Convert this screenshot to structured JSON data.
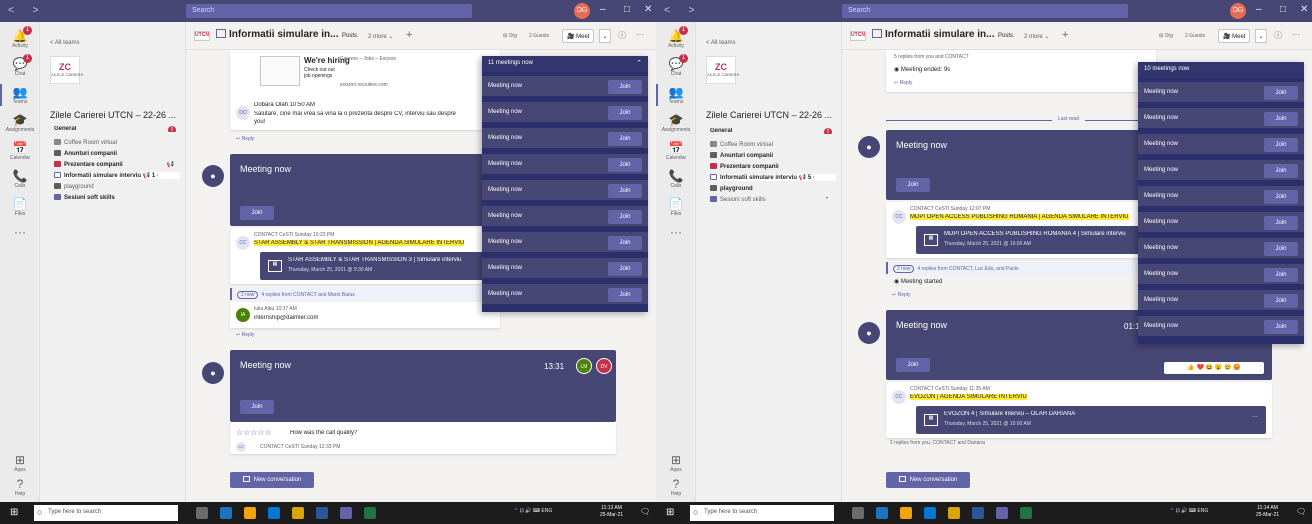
{
  "colors": {
    "brand": "#6264a7",
    "titlebar": "#464775",
    "meeting_card": "#464775",
    "overlay": "#2b2f6b",
    "alert": "#c4314b",
    "highlight": "#ffeb3b"
  },
  "titlebar": {
    "nav": "< >",
    "search_placeholder": "Search",
    "avatar_initials": "DG",
    "minimize": "–",
    "maximize": "□",
    "close": "✕"
  },
  "rail": [
    {
      "name": "activity",
      "label": "Activity",
      "icon": "bell-icon",
      "glyph": "🔔",
      "badge": "1"
    },
    {
      "name": "chat",
      "label": "Chat",
      "icon": "chat-icon",
      "glyph": "💬",
      "badge": "1"
    },
    {
      "name": "teams",
      "label": "Teams",
      "icon": "teams-icon",
      "glyph": "👥"
    },
    {
      "name": "assignments",
      "label": "Assignments",
      "icon": "assignments-icon",
      "glyph": "🎓"
    },
    {
      "name": "calendar",
      "label": "Calendar",
      "icon": "calendar-icon",
      "glyph": "📅"
    },
    {
      "name": "calls",
      "label": "Calls",
      "icon": "phone-icon",
      "glyph": "📞"
    },
    {
      "name": "files",
      "label": "Files",
      "icon": "files-icon",
      "glyph": "📄"
    },
    {
      "name": "more",
      "label": "",
      "icon": "more-icon",
      "glyph": "···"
    }
  ],
  "rail_bottom": [
    {
      "name": "apps",
      "label": "Apps",
      "icon": "apps-icon",
      "glyph": "⊞"
    },
    {
      "name": "help",
      "label": "Help",
      "icon": "help-icon",
      "glyph": "?"
    }
  ],
  "teampanel": {
    "all_teams": "< All teams",
    "logo_mark": "ZC",
    "logo_text": "ZILELE CARIERII",
    "team_name": "Zilele Carierei UTCN – 22-26 ...",
    "team_name_right": "Zilele Carierei UTCN – 22-26 ...",
    "channels_left": [
      {
        "label": "General",
        "style": "bold",
        "icon": "",
        "alert": "!"
      },
      {
        "label": "Coffee Room virtual",
        "style": "dim",
        "icon": "coffee-icon"
      },
      {
        "label": "Anunturi companii",
        "style": "bold",
        "icon": "megaphone-icon"
      },
      {
        "label": "Prezentare companii",
        "style": "bold",
        "icon": "building-icon",
        "extra": "📢"
      },
      {
        "label": "Informatii simulare interviu",
        "style": "bold sel",
        "icon": "window-icon",
        "extra": "📢 1 ·"
      },
      {
        "label": "playground",
        "style": "dim",
        "icon": "play-icon"
      },
      {
        "label": "Sesiuni soft skills",
        "style": "bold",
        "icon": "window-icon"
      }
    ],
    "channels_right": [
      {
        "label": "General",
        "style": "bold",
        "icon": "",
        "alert": "!"
      },
      {
        "label": "Coffee Room virtual",
        "style": "dim",
        "icon": "coffee-icon"
      },
      {
        "label": "Anunturi companii",
        "style": "bold",
        "icon": "megaphone-icon"
      },
      {
        "label": "Prezentare companii",
        "style": "bold",
        "icon": "building-icon"
      },
      {
        "label": "Informatii simulare interviu",
        "style": "bold sel",
        "icon": "window-icon",
        "extra": "📢 5 ·"
      },
      {
        "label": "playground",
        "style": "bold",
        "icon": "play-icon"
      },
      {
        "label": "Sesiuni soft skills",
        "style": "dim",
        "icon": "window-icon",
        "extra": "•"
      }
    ]
  },
  "channel_header": {
    "logo": "UTCN",
    "title": "Informatii simulare in...",
    "posts_tab": "Posts",
    "more_tab": "2 more ⌄",
    "add_tab": "+",
    "org": "⊞ Org",
    "guests": "2 Guests",
    "meet": "🎥 Meet",
    "caret": "⌄",
    "info": "ⓘ",
    "more": "···"
  },
  "left": {
    "hiring_card": {
      "title": "We're hiring",
      "sub1": "Check out our",
      "sub2": "job openings",
      "tags": "Careers – Jobs – Evozon",
      "link": "evozon.recruitee.com"
    },
    "message1": {
      "avatar": "DO",
      "author": "Dobara Olah",
      "time": "10:50 AM",
      "body": "Salutare, cine mai vrea sa vina la o prezenta despre CV, interviu sau despre",
      "body2": "you!",
      "reply": "↩ Reply"
    },
    "meeting1": {
      "title": "Meeting now",
      "join": "Join",
      "icon": "camera-icon"
    },
    "message2": {
      "avatar": "CC",
      "author": "CONTACT CeSTI",
      "time": "Sunday 10:23 PM",
      "headline": "STAR ASSEMBLY & STAR TRANSMISSION | AGENDA SIMULARE INTERVIU",
      "sub_title": "STAR ASSEMBLY & STAR TRANSMISSION 3 | Simulare interviu",
      "sub_when": "Thursday, March 25, 2021 @ 9:30 AM",
      "new_pill": "2 new",
      "replies": "4 replies from CONTACT and Mario Barus"
    },
    "message3": {
      "avatar": "IA",
      "author": "Iulia Albu",
      "time": "10:37 AM",
      "body": "internship@daimler.com",
      "reply": "↩ Reply"
    },
    "meeting2": {
      "title": "Meeting now",
      "time": "13:31",
      "join": "Join",
      "p1": "LM",
      "p2": "DV"
    },
    "rating": {
      "stars": "☆☆☆☆☆",
      "question": "How was the call quality?"
    },
    "message4": {
      "avatar": "CC",
      "author": "CONTACT CeSTI",
      "time": "Sunday 12:33 PM"
    },
    "new_conversation": "New conversation"
  },
  "overlay_left": {
    "header": "11 meetings now",
    "rows": [
      {
        "label": "Meeting now",
        "join": "Join"
      },
      {
        "label": "Meeting now",
        "join": "Join"
      },
      {
        "label": "Meeting now",
        "join": "Join"
      },
      {
        "label": "Meeting now",
        "join": "Join"
      },
      {
        "label": "Meeting now",
        "join": "Join"
      },
      {
        "label": "Meeting now",
        "join": "Join"
      },
      {
        "label": "Meeting now",
        "join": "Join"
      },
      {
        "label": "Meeting now",
        "join": "Join"
      },
      {
        "label": "Meeting now",
        "join": "Join"
      }
    ]
  },
  "right": {
    "top_replies": "5 replies from you and CONTACT",
    "meeting_ended": "Meeting ended: 9s",
    "reply": "↩ Reply",
    "last_read": "Last read",
    "meeting1": {
      "title": "Meeting now",
      "join": "Join"
    },
    "message1": {
      "avatar": "CC",
      "author": "CONTACT CeSTI",
      "time": "Sunday 12:07 PM",
      "headline": "MDPI OPEN ACCESS PUBLISHING ROMANIA | AGENDA SIMULARE INTERVIU",
      "sub_title": "MDPI OPEN ACCESS PUBLISHING ROMANIA 4 | Simulare interviu",
      "sub_when": "Thursday, March 25, 2021 @ 10:00 AM",
      "new_pill": "2 new",
      "replies": "4 replies from CONTACT, Luc Edo, and Paolo",
      "started": "Meeting started",
      "reply": "↩ Reply"
    },
    "meeting2": {
      "title": "Meeting now",
      "time": "01:13:23",
      "join": "Join",
      "participants": [
        "",
        "",
        "",
        "",
        "+1"
      ],
      "reactions": "👍 ❤️ 😆 😮 😢 😡"
    },
    "message2": {
      "avatar": "CC",
      "author": "CONTACT CeSTI",
      "time": "Sunday 11:35 AM",
      "headline": "EVOZON | AGENDA SIMULARE INTERVIU",
      "sub_title": "EVOZON 4 | Simulare interviu – OLAH DARIANA",
      "sub_when": "Thursday, March 25, 2021 @ 10:00 AM",
      "sub_more": "···",
      "replies": "2 replies from you, CONTACT and Dariana"
    },
    "new_conversation": "New conversation"
  },
  "overlay_right": {
    "header": "10 meetings now",
    "rows": [
      {
        "label": "Meeting now",
        "join": "Join"
      },
      {
        "label": "Meeting now",
        "join": "Join"
      },
      {
        "label": "Meeting now",
        "join": "Join"
      },
      {
        "label": "Meeting now",
        "join": "Join"
      },
      {
        "label": "Meeting now",
        "join": "Join"
      },
      {
        "label": "Meeting now",
        "join": "Join"
      },
      {
        "label": "Meeting now",
        "join": "Join"
      },
      {
        "label": "Meeting now",
        "join": "Join"
      },
      {
        "label": "Meeting now",
        "join": "Join"
      },
      {
        "label": "Meeting now",
        "join": "Join"
      }
    ]
  },
  "taskbar_left": {
    "search": "Type here to search",
    "tray": "⌃ ⊡ 🔊 ⌨ ENG",
    "time": "11:13 AM",
    "date": "25-Mar-21",
    "notif": "🗨"
  },
  "taskbar_right": {
    "search": "Type here to search",
    "tray": "⌃ ⊡ 🔊 ⌨ ENG",
    "time": "11:14 AM",
    "date": "25-Mar-21",
    "notif": "🗨"
  }
}
